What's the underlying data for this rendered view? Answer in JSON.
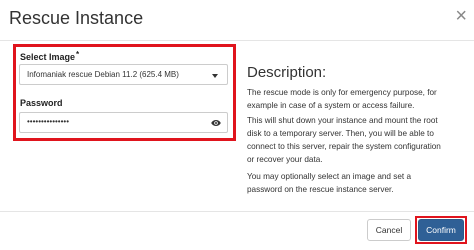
{
  "dialog": {
    "title": "Rescue Instance",
    "close_glyph": "×"
  },
  "form": {
    "select_image_label": "Select Image",
    "required_marker": "*",
    "select_image_value": "Infomaniak rescue Debian 11.2 (625.4 MB)",
    "password_label": "Password",
    "password_value": "•••••••••••••••",
    "icons": {
      "select": "chevron-down-icon",
      "password": "eye-icon"
    }
  },
  "description": {
    "title": "Description:",
    "paragraph1_lines": [
      "The rescue mode is only for emergency purpose, for",
      "example in case of a system or access failure."
    ],
    "paragraph2_lines": [
      "This will shut down your instance and mount the root",
      "disk to a temporary server. Then, you will be able to",
      "connect to this server, repair the system configuration",
      "or recover your data."
    ],
    "paragraph3_lines": [
      "You may optionally select an image and set a",
      "password on the rescue instance server."
    ]
  },
  "footer": {
    "cancel_label": "Cancel",
    "confirm_label": "Confirm"
  },
  "colors": {
    "highlight": "#e0141d",
    "primary": "#2f6096"
  }
}
